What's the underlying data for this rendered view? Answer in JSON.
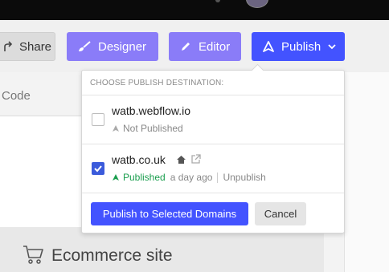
{
  "toolbar": {
    "share_label": "Share",
    "designer_label": "Designer",
    "editor_label": "Editor",
    "publish_label": "Publish"
  },
  "sidebar": {
    "code_label": "Code"
  },
  "canvas": {
    "ecommerce_title": "Ecommerce site"
  },
  "publish_dropdown": {
    "header": "CHOOSE PUBLISH DESTINATION:",
    "domains": [
      {
        "name": "watb.webflow.io",
        "checked": false,
        "status": "Not Published"
      },
      {
        "name": "watb.co.uk",
        "checked": true,
        "status": "Published",
        "time": "a day ago",
        "action": "Unpublish"
      }
    ],
    "publish_button": "Publish to Selected Domains",
    "cancel_button": "Cancel"
  },
  "colors": {
    "publish_blue": "#4353ff",
    "designer_purple": "#8a7cf8",
    "published_green": "#1a9e4e"
  }
}
